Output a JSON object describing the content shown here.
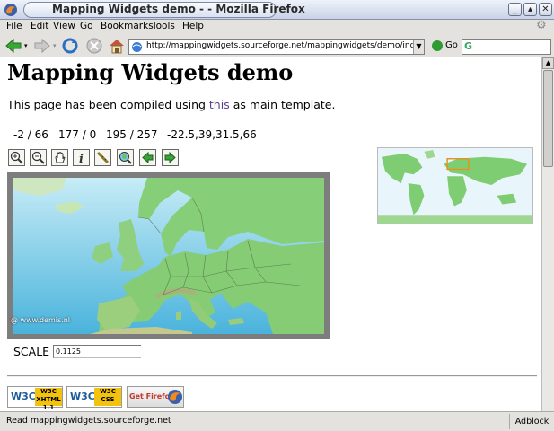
{
  "window": {
    "title": "Mapping Widgets demo - - Mozilla Firefox"
  },
  "menu": {
    "items": [
      "File",
      "Edit",
      "View",
      "Go",
      "Bookmarks",
      "Tools",
      "Help"
    ]
  },
  "toolbar": {
    "url": "http://mappingwidgets.sourceforge.net/mappingwidgets/demo/index.phtml",
    "go_label": "Go",
    "search_value": "",
    "icons": [
      "back-icon",
      "forward-icon",
      "reload-icon",
      "stop-icon",
      "home-icon"
    ]
  },
  "page": {
    "title": "Mapping Widgets demo",
    "intro_before": "This page has been compiled using ",
    "intro_link": "this",
    "intro_after": " as main template.",
    "coords": [
      "-2 / 66",
      "177 / 0",
      "195 / 257",
      "-22.5,39,31.5,66"
    ],
    "tools": [
      "zoom-in-icon",
      "zoom-out-icon",
      "pan-hand-icon",
      "info-icon",
      "measure-icon",
      "zoom-full-icon",
      "back-extent-icon",
      "forward-extent-icon"
    ],
    "map_credit": "@ www.demis.nl",
    "scale_label": "SCALE",
    "scale_value": "0.1125",
    "badges": [
      "W3C XHTML 1.1",
      "W3C CSS",
      "Get Firefox"
    ]
  },
  "status": {
    "text": "Read mappingwidgets.sourceforge.net",
    "adblock": "Adblock"
  },
  "colors": {
    "link": "#5a3f8e",
    "sea": "#a7dff0",
    "land": "#7fcd72"
  }
}
